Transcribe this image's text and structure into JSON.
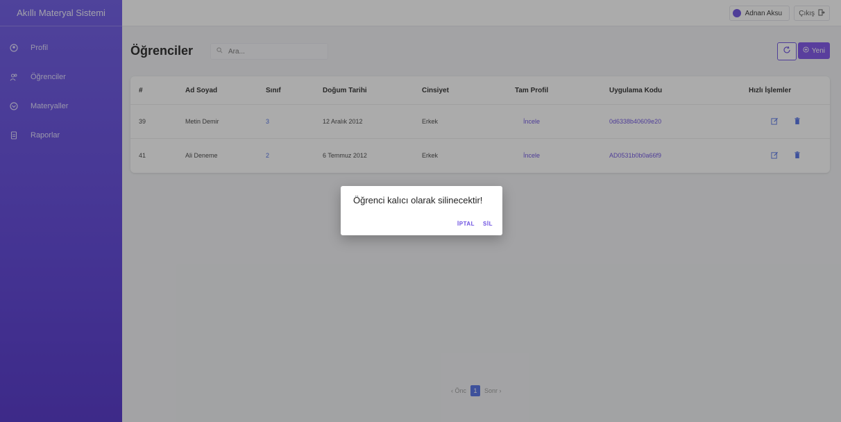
{
  "app": {
    "title": "Akıllı Materyal Sistemi"
  },
  "sidebar": {
    "items": [
      {
        "label": "Profil",
        "icon": "user-circle-icon"
      },
      {
        "label": "Öğrenciler",
        "icon": "users-icon"
      },
      {
        "label": "Materyaller",
        "icon": "box-icon"
      },
      {
        "label": "Raporlar",
        "icon": "document-icon"
      }
    ]
  },
  "topbar": {
    "user_name": "Adnan Aksu",
    "logout_label": "Çıkış"
  },
  "page": {
    "title": "Öğrenciler",
    "search_placeholder": "Ara...",
    "new_button": "Yeni"
  },
  "table": {
    "headers": [
      "#",
      "Ad Soyad",
      "Sınıf",
      "Doğum Tarihi",
      "Cinsiyet",
      "Tam Profil",
      "Uygulama Kodu",
      "Hızlı İşlemler"
    ],
    "rows": [
      {
        "id": "39",
        "name": "Metin Demir",
        "class": "3",
        "dob": "12 Aralık 2012",
        "gender": "Erkek",
        "profile": "İncele",
        "code": "0d6338b40609e20"
      },
      {
        "id": "41",
        "name": "Ali Deneme",
        "class": "2",
        "dob": "6 Temmuz 2012",
        "gender": "Erkek",
        "profile": "İncele",
        "code": "AD0531b0b0a66f9"
      }
    ]
  },
  "pagination": {
    "prev": "‹ Önc",
    "current": "1",
    "next": "Sonr ›"
  },
  "dialog": {
    "message": "Öğrenci kalıcı olarak silinecektir!",
    "cancel": "İPTAL",
    "confirm": "SİL"
  },
  "colors": {
    "accent": "#6b4fe0",
    "link_blue": "#4f6fe6"
  }
}
